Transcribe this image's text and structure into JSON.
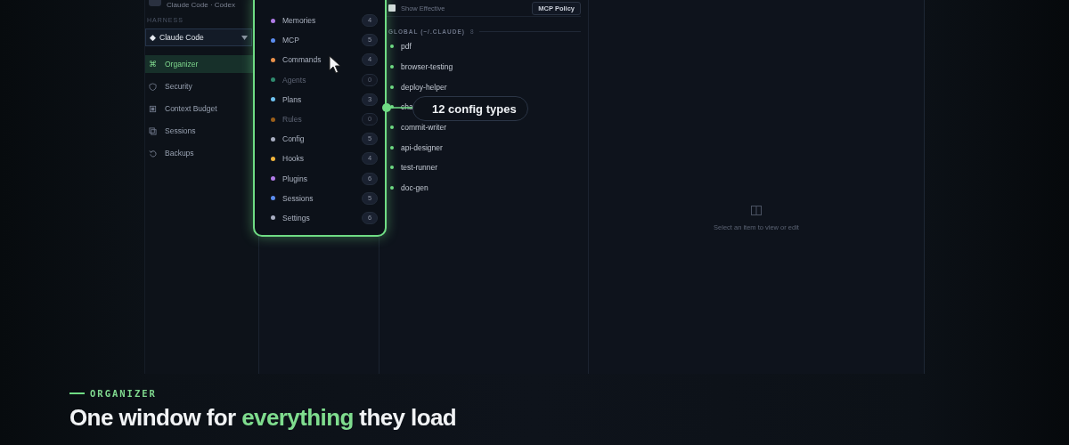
{
  "sidebar": {
    "account": "Claude Code · Codex",
    "harness_label": "HARNESS",
    "harness_select": {
      "icon": "◆",
      "value": "Claude Code"
    },
    "items": [
      {
        "label": "Organizer",
        "icon": "⌘",
        "selected": true
      },
      {
        "label": "Security",
        "selected": false
      },
      {
        "label": "Context Budget",
        "selected": false
      },
      {
        "label": "Sessions",
        "selected": false
      },
      {
        "label": "Backups",
        "selected": false
      }
    ]
  },
  "categories": [
    {
      "label": "Memories",
      "count": "4",
      "color": "#b07be6",
      "disabled": false
    },
    {
      "label": "MCP",
      "count": "5",
      "color": "#5b8def",
      "disabled": false
    },
    {
      "label": "Commands",
      "count": "4",
      "color": "#e8904a",
      "disabled": false
    },
    {
      "label": "Agents",
      "count": "0",
      "color": "#2f8a6e",
      "disabled": true
    },
    {
      "label": "Plans",
      "count": "3",
      "color": "#6ec1f0",
      "disabled": false
    },
    {
      "label": "Rules",
      "count": "0",
      "color": "#9a5e1a",
      "disabled": true
    },
    {
      "label": "Config",
      "count": "5",
      "color": "#a8adc0",
      "disabled": false
    },
    {
      "label": "Hooks",
      "count": "4",
      "color": "#f0b43c",
      "disabled": false
    },
    {
      "label": "Plugins",
      "count": "6",
      "color": "#b07be6",
      "disabled": false
    },
    {
      "label": "Sessions",
      "count": "5",
      "color": "#5b8def",
      "disabled": false
    },
    {
      "label": "Settings",
      "count": "6",
      "color": "#a8adc0",
      "disabled": false
    }
  ],
  "list": {
    "show_effective": {
      "label": "Show Effective",
      "checked": false
    },
    "policy_button": "MCP Policy",
    "group": {
      "title": "GLOBAL (~/.CLAUDE)",
      "count": "8"
    },
    "items": [
      "pdf",
      "browser-testing",
      "deploy-helper",
      "cha",
      "commit-writer",
      "api-designer",
      "test-runner",
      "doc-gen"
    ]
  },
  "callout": "12 config types",
  "detail": {
    "empty_text": "Select an item to view or edit"
  },
  "hero": {
    "eyebrow": "ORGANIZER",
    "headline": [
      {
        "text": "One window for ",
        "accent": false
      },
      {
        "text": "everything",
        "accent": true
      },
      {
        "text": " they load",
        "accent": false
      }
    ]
  }
}
